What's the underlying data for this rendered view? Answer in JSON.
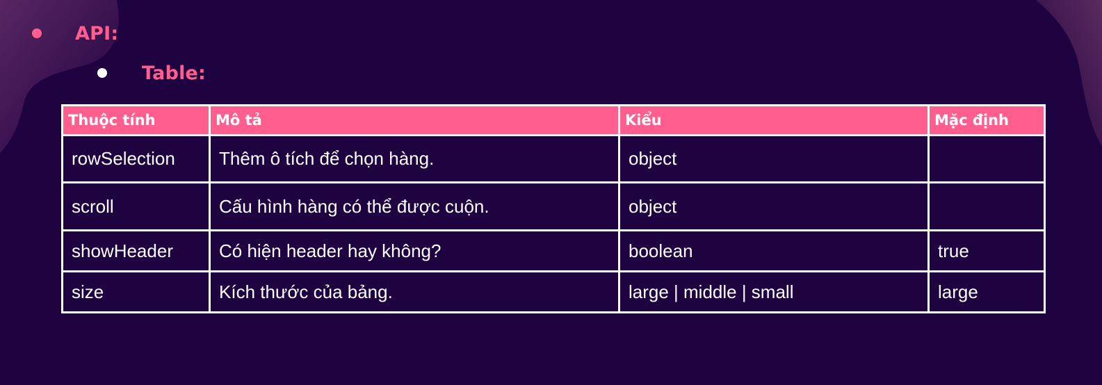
{
  "colors": {
    "background": "#1f0240",
    "accent_pink": "#ff5e8e",
    "text_white": "#ffffff"
  },
  "bullets": {
    "level1_label": "API:",
    "level2_label": "Table:"
  },
  "table": {
    "headers": [
      "Thuộc tính",
      "Mô tả",
      "Kiểu",
      "Mặc định"
    ],
    "rows": [
      [
        "rowSelection",
        "Thêm ô tích để chọn hàng.",
        "object",
        ""
      ],
      [
        "scroll",
        "Cấu hình hàng có thể được cuộn.",
        "object",
        ""
      ],
      [
        "showHeader",
        "Có hiện header hay không?",
        "boolean",
        "true"
      ],
      [
        "size",
        "Kích thước của bảng.",
        "large | middle | small",
        "large"
      ]
    ]
  }
}
